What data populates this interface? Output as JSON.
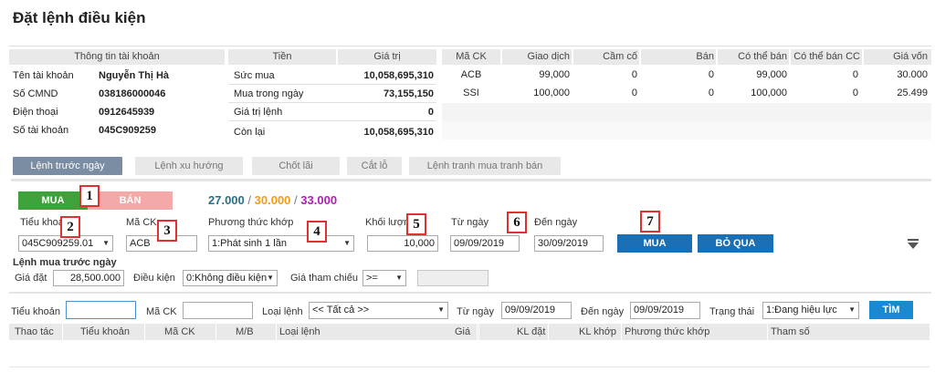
{
  "page": {
    "title": "Đặt lệnh điều kiện"
  },
  "account": {
    "header": "Thông tin tài khoản",
    "rows": [
      {
        "label": "Tên tài khoản",
        "value": "Nguyễn Thị Hà"
      },
      {
        "label": "Số CMND",
        "value": "038186000046"
      },
      {
        "label": "Điện thoại",
        "value": "0912645939"
      },
      {
        "label": "Số tài khoản",
        "value": "045C909259"
      }
    ]
  },
  "money": {
    "headers": [
      "Tiền",
      "Giá trị"
    ],
    "rows": [
      {
        "label": "Sức mua",
        "value": "10,058,695,310"
      },
      {
        "label": "Mua trong ngày",
        "value": "73,155,150"
      },
      {
        "label": "Giá trị lệnh",
        "value": "0"
      },
      {
        "label": "Còn lại",
        "value": "10,058,695,310"
      }
    ]
  },
  "holdings": {
    "headers": [
      "Mã CK",
      "Giao dịch",
      "Cầm cố",
      "Bán",
      "Có thể bán",
      "Có thể bán CC",
      "Giá vốn"
    ],
    "rows": [
      [
        "ACB",
        "99,000",
        "0",
        "0",
        "99,000",
        "0",
        "30.000"
      ],
      [
        "SSI",
        "100,000",
        "0",
        "0",
        "100,000",
        "0",
        "25.499"
      ]
    ]
  },
  "tabs": [
    "Lệnh trước ngày",
    "Lệnh xu hướng",
    "Chốt lãi",
    "Cắt lỗ",
    "Lệnh tranh mua tranh bán"
  ],
  "order": {
    "buy": "MUA",
    "sell": "BÁN",
    "price_ref": "27.000",
    "price_open": "30.000",
    "price_ceil": "33.000",
    "sep": "/",
    "sub_account_label": "Tiểu khoản",
    "sub_account_value": "045C909259.01",
    "symbol_label": "Mã CK",
    "symbol_value": "ACB",
    "match_method_label": "Phương thức khớp",
    "match_method_value": "1:Phát sinh 1 lần",
    "volume_label": "Khối lượng",
    "volume_value": "10,000",
    "from_label": "Từ ngày",
    "from_value": "09/09/2019",
    "to_label": "Đến ngày",
    "to_value": "30/09/2019",
    "submit": "MUA",
    "skip": "BỎ QUA",
    "section_title": "Lệnh mua trước ngày",
    "price_label": "Giá đặt",
    "price_value": "28,500.000",
    "condition_label": "Điều kiện",
    "condition_value": "0:Không điều kiện",
    "ref_label": "Giá tham chiếu",
    "ref_op": ">=",
    "ref_value": ""
  },
  "markers": [
    "1",
    "2",
    "3",
    "4",
    "5",
    "6",
    "7"
  ],
  "filter": {
    "sub_account_label": "Tiểu khoản",
    "sub_account_value": "",
    "symbol_label": "Mã CK",
    "symbol_value": "",
    "type_label": "Loại lệnh",
    "type_value": "<< Tất cả >>",
    "from_label": "Từ ngày",
    "from_value": "09/09/2019",
    "to_label": "Đến ngày",
    "to_value": "09/09/2019",
    "status_label": "Trạng thái",
    "status_value": "1:Đang hiệu lực",
    "search": "TÌM"
  },
  "results": {
    "headers": [
      "Thao tác",
      "Tiểu khoản",
      "Mã CK",
      "M/B",
      "Loại lệnh",
      "Giá",
      "KL đặt",
      "KL khớp",
      "Phương thức khớp",
      "Tham số"
    ]
  },
  "colors": {
    "buy": "#3ea23a",
    "sell": "#f4a9a9",
    "primary": "#1a6fb5",
    "tab_active": "#7b8da3",
    "marker": "#e03030"
  }
}
